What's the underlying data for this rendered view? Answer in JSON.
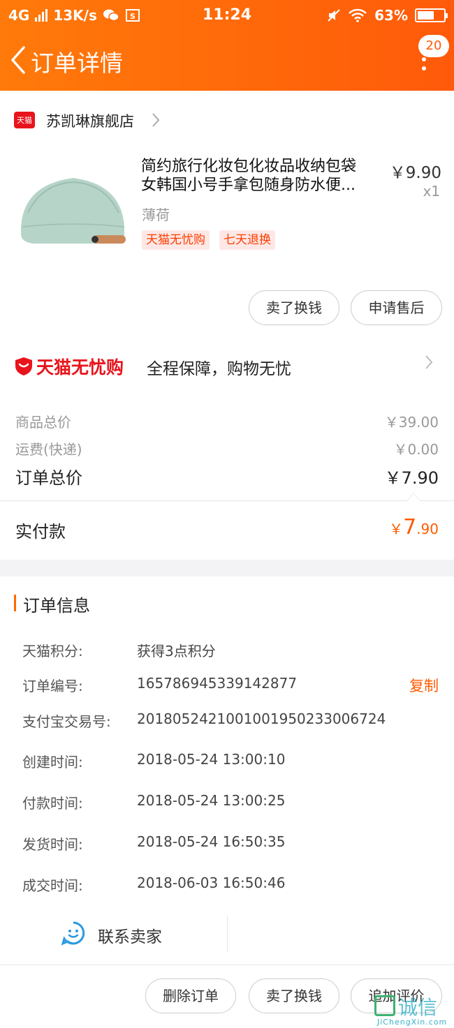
{
  "status_bar": {
    "network": "4G",
    "speed": "13K/s",
    "time": "11:24",
    "battery": "63%",
    "battery_level": 0.63
  },
  "header": {
    "title": "订单详情",
    "badge": "20"
  },
  "shop": {
    "logo_text": "天猫",
    "name": "苏凯琳旗舰店"
  },
  "product": {
    "title_line1": "简约旅行化妆包化妆品收纳包袋",
    "title_line2": "女韩国小号手拿包随身防水便...",
    "price": "￥9.90",
    "quantity": "x1",
    "variant": "薄荷",
    "tags": [
      "天猫无忧购",
      "七天退换"
    ],
    "actions": [
      "卖了换钱",
      "申请售后"
    ]
  },
  "guarantee": {
    "brand": "天猫无忧购",
    "text": "全程保障，购物无忧"
  },
  "price_summary": {
    "goods_label": "商品总价",
    "goods_value": "￥39.00",
    "shipping_label": "运费(快递)",
    "shipping_value": "￥0.00",
    "total_label": "订单总价",
    "total_value": "￥7.90",
    "paid_label": "实付款",
    "paid_currency": "￥",
    "paid_int": "7",
    "paid_dec": ".90"
  },
  "order_info": {
    "title": "订单信息",
    "copy_label": "复制",
    "rows": [
      {
        "label": "天猫积分:",
        "value": "获得3点积分"
      },
      {
        "label": "订单编号:",
        "value": "165786945339142877"
      },
      {
        "label": "支付宝交易号:",
        "value": "2018052421001001950233006724"
      },
      {
        "label": "创建时间:",
        "value": "2018-05-24 13:00:10"
      },
      {
        "label": "付款时间:",
        "value": "2018-05-24 13:00:25"
      },
      {
        "label": "发货时间:",
        "value": "2018-05-24 16:50:35"
      },
      {
        "label": "成交时间:",
        "value": "2018-06-03 16:50:46"
      }
    ]
  },
  "contact": {
    "label": "联系卖家"
  },
  "bottom_actions": [
    "删除订单",
    "卖了换钱",
    "追加评价"
  ],
  "watermark": {
    "text": "诚信",
    "sub": "JiChengXin.com"
  },
  "colors": {
    "header_start": "#ff7a0a",
    "header_end": "#ff5a0a",
    "tmall_red": "#e8141c",
    "accent_orange": "#ff5a00"
  }
}
